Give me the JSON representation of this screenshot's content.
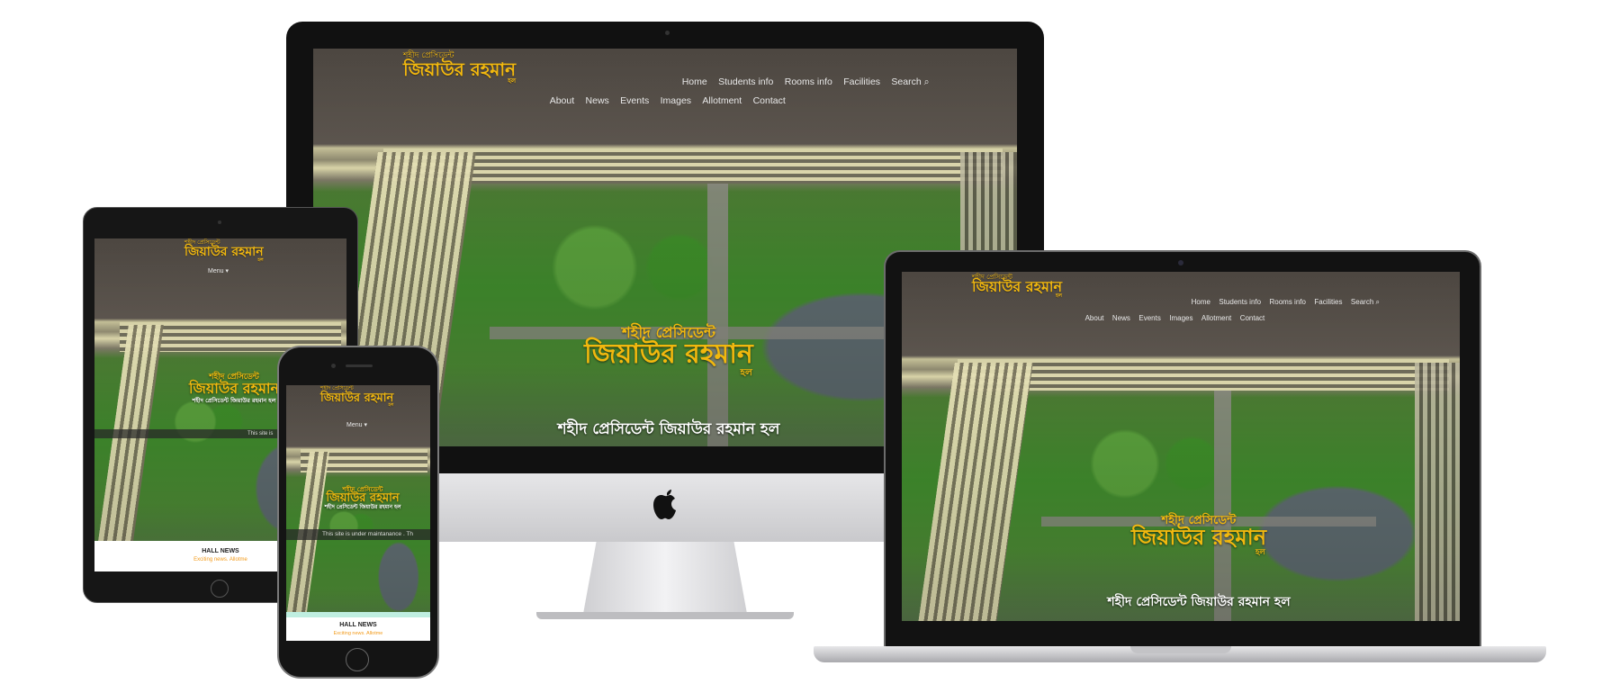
{
  "site": {
    "logo_top": "শহীদ প্রেসিডেন্ট",
    "logo_main": "জিয়াউর রহমান",
    "logo_sub": "হল",
    "hero_top": "শহীদ প্রেসিডেন্ট",
    "hero_main": "জিয়াউর রহমান",
    "hero_sub": "হল",
    "hero_caption": "শহীদ প্রেসিডেন্ট জিয়াউর রহমান হল",
    "hero_caption_small": "শহীদ প্রেসিডেন্ট জিয়াউর রহমান হল"
  },
  "nav": {
    "row1": [
      "Home",
      "Students info",
      "Rooms info",
      "Facilities",
      "Search"
    ],
    "row2": [
      "About",
      "News",
      "Events",
      "Images",
      "Allotment",
      "Contact"
    ],
    "laptop_row1": [
      "Home",
      "Students info",
      "Rooms info",
      "Facilities",
      "Search"
    ],
    "menu_label": "Menu ▾"
  },
  "notice": {
    "text": "This site is under maintanance . Th",
    "tablet_text": "This site is"
  },
  "news": {
    "heading": "HALL NEWS",
    "sub": "Exciting news. Allotme"
  },
  "colors": {
    "accent": "#f2b80e",
    "news_highlight": "#f29a1a",
    "device_frame": "#1a1a1a"
  }
}
